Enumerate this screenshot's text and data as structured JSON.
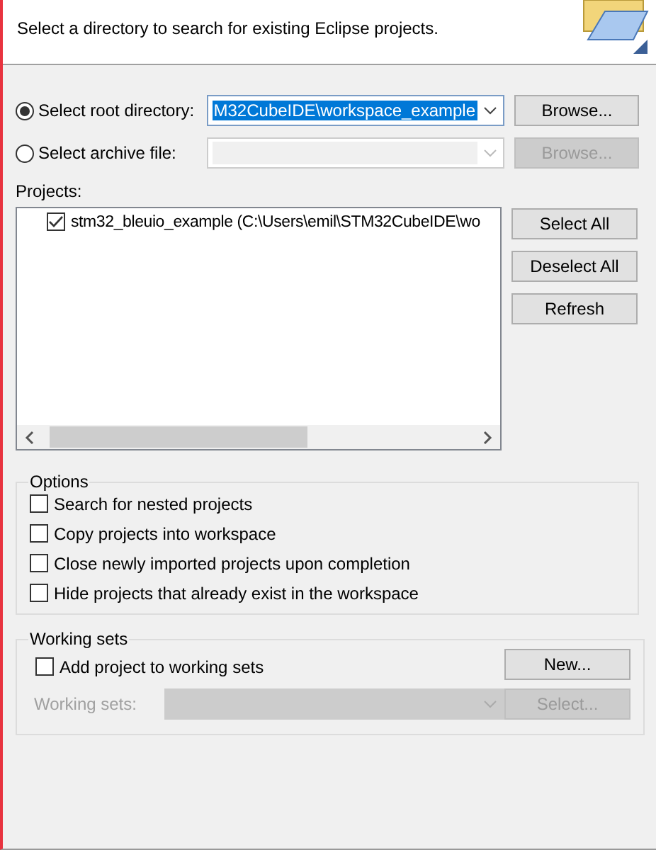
{
  "header": {
    "description": "Select a directory to search for existing Eclipse projects."
  },
  "sources": [
    {
      "label": "Select root directory:",
      "selected": true,
      "value": "M32CubeIDE\\workspace_example",
      "disabled": false,
      "button": "Browse..."
    },
    {
      "label": "Select archive file:",
      "selected": false,
      "disabled": true,
      "button": "Browse..."
    }
  ],
  "projects": {
    "label": "Projects:",
    "items": [
      {
        "text": "stm32_bleuio_example (C:\\Users\\emil\\STM32CubeIDE\\wo",
        "checked": true
      }
    ],
    "buttons": [
      "Select All",
      "Deselect All",
      "Refresh"
    ]
  },
  "options": {
    "title": "Options",
    "items": [
      {
        "label": "Search for nested projects",
        "checked": false
      },
      {
        "label": "Copy projects into workspace",
        "checked": false
      },
      {
        "label": "Close newly imported projects upon completion",
        "checked": false
      },
      {
        "label": "Hide projects that already exist in the workspace",
        "checked": false
      }
    ]
  },
  "working_sets": {
    "title": "Working sets",
    "add": {
      "label": "Add project to working sets",
      "checked": false
    },
    "new_button": "New...",
    "field_label": "Working sets:",
    "disabled": true,
    "select_button": "Select..."
  }
}
